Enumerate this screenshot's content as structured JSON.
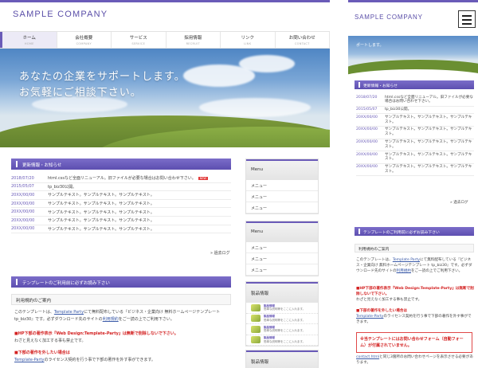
{
  "company_name": "SAMPLE COMPANY",
  "nav": [
    {
      "jp": "ホーム",
      "en": "HOME",
      "active": true
    },
    {
      "jp": "会社概要",
      "en": "COMPANY",
      "active": false
    },
    {
      "jp": "サービス",
      "en": "SERVICE",
      "active": false
    },
    {
      "jp": "採用情報",
      "en": "RECRUIT",
      "active": false
    },
    {
      "jp": "リンク",
      "en": "LINK",
      "active": false
    },
    {
      "jp": "お問い合わせ",
      "en": "CONTACT",
      "active": false
    }
  ],
  "hero": {
    "line1": "あなたの企業をサポートします。",
    "line2": "お気軽にご相談下さい。",
    "mobile_line": "ポートします。"
  },
  "news": {
    "heading": "更新情報・お知らせ",
    "badge": "NEW",
    "more": "» 過去ログ",
    "items": [
      {
        "date": "2018/07/20",
        "text": "html.cssなど全面リニューアル。旧ファイルが必要な場合はお問い合わせ下さい。",
        "mobile_text": "html.cssなど全面リニューアル。旧ファイルが必要な場合はお問い合わせ下さい。"
      },
      {
        "date": "2015/05/07",
        "text": "tp_biz30公開。",
        "mobile_text": "tp_biz30公開。"
      },
      {
        "date": "20XX/00/00",
        "text": "サンプルテキスト。サンプルテキスト。サンプルテキスト。",
        "mobile_text": "サンプルテキスト。サンプルテキスト。サンプルテキスト。"
      },
      {
        "date": "20XX/00/00",
        "text": "サンプルテキスト。サンプルテキスト。サンプルテキスト。",
        "mobile_text": "サンプルテキスト。サンプルテキスト。サンプルテキスト。"
      },
      {
        "date": "20XX/00/00",
        "text": "サンプルテキスト。サンプルテキスト。サンプルテキスト。",
        "mobile_text": "サンプルテキスト。サンプルテキスト。サンプルテキスト。"
      },
      {
        "date": "20XX/00/00",
        "text": "サンプルテキスト。サンプルテキスト。サンプルテキスト。",
        "mobile_text": "サンプルテキスト。サンプルテキスト。サンプルテキスト。"
      },
      {
        "date": "20XX/00/00",
        "text": "サンプルテキスト。サンプルテキスト。サンプルテキスト。",
        "mobile_text": "サンプルテキスト。サンプルテキスト。サンプルテキスト。"
      }
    ]
  },
  "template": {
    "heading": "テンプレートのご利用前に必ずお読み下さい",
    "sub_heading": "利用規約のご案内",
    "intro_pre": "このテンプレートは、",
    "intro_link": "Template Party",
    "intro_post": "にて無料配布している『ビジネス・企業向け 無料ホームページテンプレート tp_biz30』です。必ずダウンロード先のサイトの",
    "intro_link2": "利用規約",
    "intro_end": "をご一読の上でご利用下さい。",
    "rule1_red": "■HP下部の著作表示『Web Design:Template-Party』は無断で削除しないで下さい。",
    "rule1_note": "わざと見えなく加工する事も禁止です。",
    "rule2_red": "■下部の著作を外したい場合は",
    "rule2_link": "Template-Party",
    "rule2_text": "のライセンス契約を行う事で下部の著作を外す事ができます。",
    "box_text": "※当テンプレートにはお問い合わせフォーム（自動フォーム）が付属されていません。",
    "contact_pre": "",
    "contact_link": "contact.html",
    "contact_post": "と同じ3箇所のお問い合わせページを表示させる必要があります。"
  },
  "sidebar": {
    "menu1": {
      "title": "Menu",
      "items": [
        "メニュー",
        "メニュー",
        "メニュー"
      ]
    },
    "menu2": {
      "title": "Menu",
      "items": [
        "メニュー",
        "メニュー",
        "メニュー"
      ]
    },
    "products": {
      "title": "製品情報",
      "items": [
        {
          "name": "製品情報",
          "desc": "簡単な説明等をここに入れます。"
        },
        {
          "name": "製品情報",
          "desc": "簡単な説明等をここに入れます。"
        },
        {
          "name": "製品情報",
          "desc": "簡単な説明等をここに入れます。"
        },
        {
          "name": "製品情報",
          "desc": "簡単な説明等をここに入れます。"
        }
      ]
    },
    "products2": {
      "title": "製品情報"
    }
  },
  "colors": {
    "accent": "#6a5bb8",
    "red": "#d32020"
  }
}
